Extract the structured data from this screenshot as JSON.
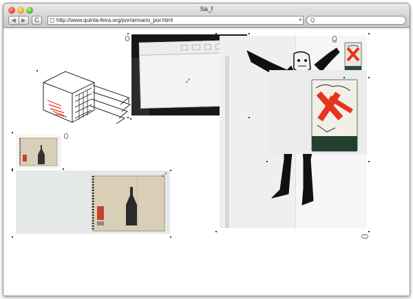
{
  "window": {
    "title": "Sa_f",
    "url": "http://www.quinta-feira.org/por/armario_por.html",
    "search_icon": "magnifier-icon",
    "colors": {
      "titlebar_top": "#e9e9e9",
      "titlebar_bottom": "#c4c4c4",
      "close": "#e0463a",
      "minimize": "#e5a822",
      "maximize": "#58b536"
    }
  },
  "toolbar": {
    "back_icon": "back-arrow-icon",
    "forward_icon": "forward-arrow-icon",
    "reload_icon": "reload-icon",
    "back_glyph": "◀",
    "forward_glyph": "▶",
    "reload_glyph": "C",
    "search_glyph": "Q",
    "url_caret": "▾"
  },
  "page": {
    "expand_glyph": "⤢",
    "accent_red": "#e8331c",
    "items": [
      {
        "name": "drawer-cabinet-drawing"
      },
      {
        "name": "envelope-photo"
      },
      {
        "name": "masked-figure-photo"
      },
      {
        "name": "matchbox-small"
      },
      {
        "name": "matchbox-large"
      },
      {
        "name": "notebook-small"
      },
      {
        "name": "notebook-large"
      }
    ]
  }
}
